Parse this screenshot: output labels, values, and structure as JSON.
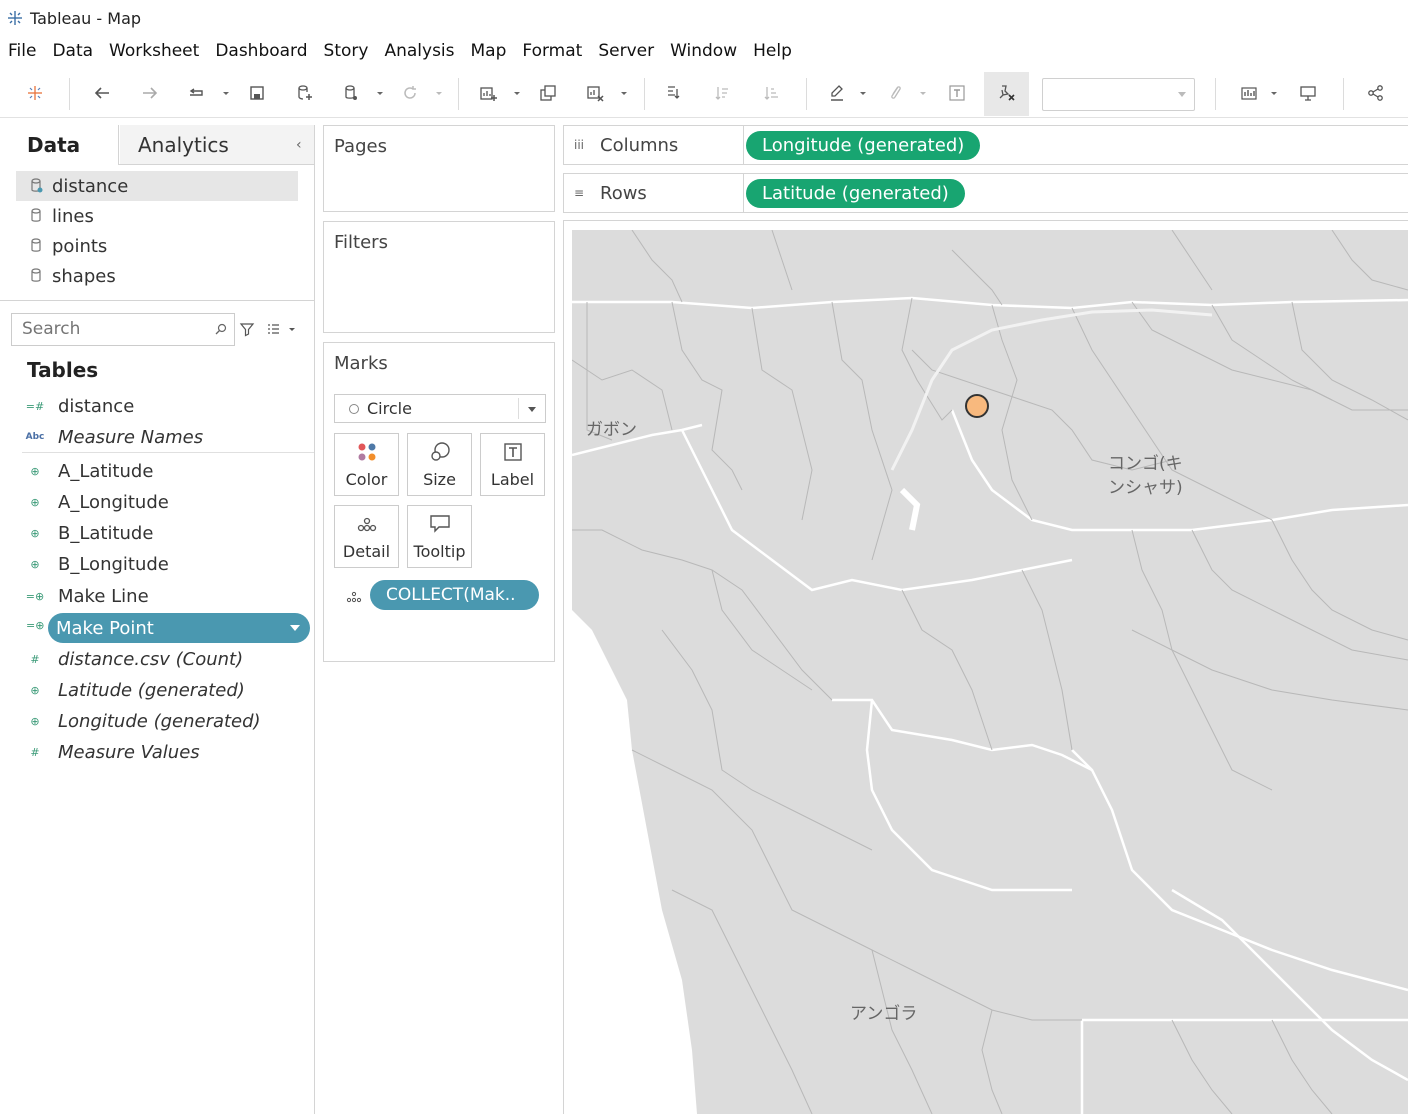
{
  "window": {
    "title": "Tableau - Map"
  },
  "menu": [
    "File",
    "Data",
    "Worksheet",
    "Dashboard",
    "Story",
    "Analysis",
    "Map",
    "Format",
    "Server",
    "Window",
    "Help"
  ],
  "toolbar": {
    "icons": [
      "tableau-logo-icon",
      "undo-icon",
      "redo-icon",
      "redo-dropdown-icon",
      "save-icon",
      "new-datasource-icon",
      "datasource-icon",
      "refresh-icon",
      "new-sheet-icon",
      "duplicate-sheet-icon",
      "clear-sheet-icon",
      "swap-icon",
      "sort-ascending-icon",
      "sort-descending-icon",
      "highlight-icon",
      "group-icon",
      "show-labels-icon",
      "fix-axes-icon",
      "show-me-icon",
      "presentation-icon",
      "share-icon"
    ],
    "fit_value": ""
  },
  "data_pane": {
    "tabs": {
      "data": "Data",
      "analytics": "Analytics"
    },
    "datasources": [
      {
        "label": "distance",
        "selected": true
      },
      {
        "label": "lines",
        "selected": false
      },
      {
        "label": "points",
        "selected": false
      },
      {
        "label": "shapes",
        "selected": false
      }
    ],
    "search_placeholder": "Search",
    "tables_header": "Tables",
    "fields": [
      {
        "label": "distance",
        "icon": "=#",
        "italic": false
      },
      {
        "label": "Measure Names",
        "icon": "Abc",
        "italic": true
      },
      {
        "label": "A_Latitude",
        "icon": "⊕",
        "italic": false
      },
      {
        "label": "A_Longitude",
        "icon": "⊕",
        "italic": false
      },
      {
        "label": "B_Latitude",
        "icon": "⊕",
        "italic": false
      },
      {
        "label": "B_Longitude",
        "icon": "⊕",
        "italic": false
      },
      {
        "label": "Make Line",
        "icon": "=⊕",
        "italic": false
      },
      {
        "label": "Make Point",
        "icon": "=⊕",
        "italic": false,
        "selected": true
      },
      {
        "label": "distance.csv (Count)",
        "icon": "#",
        "italic": true
      },
      {
        "label": "Latitude (generated)",
        "icon": "⊕",
        "italic": true
      },
      {
        "label": "Longitude (generated)",
        "icon": "⊕",
        "italic": true
      },
      {
        "label": "Measure Values",
        "icon": "#",
        "italic": true
      }
    ]
  },
  "cards": {
    "pages": "Pages",
    "filters": "Filters",
    "marks": {
      "title": "Marks",
      "mark_type": "Circle",
      "buttons": [
        "Color",
        "Size",
        "Label",
        "Detail",
        "Tooltip"
      ],
      "pill": "COLLECT(Mak.."
    }
  },
  "shelves": {
    "columns": {
      "label": "Columns",
      "icon": "iii",
      "pill": "Longitude (generated)"
    },
    "rows": {
      "label": "Rows",
      "icon": "≡",
      "pill": "Latitude (generated)"
    }
  },
  "map": {
    "labels": [
      "ガボン",
      "コンゴ(キ",
      "ンシャサ)",
      "アンゴラ"
    ],
    "point_color": "#f8b97e",
    "background": "#dcdcdc"
  },
  "colors": {
    "accent_teal": "#4a98b0",
    "accent_green": "#18a571"
  }
}
